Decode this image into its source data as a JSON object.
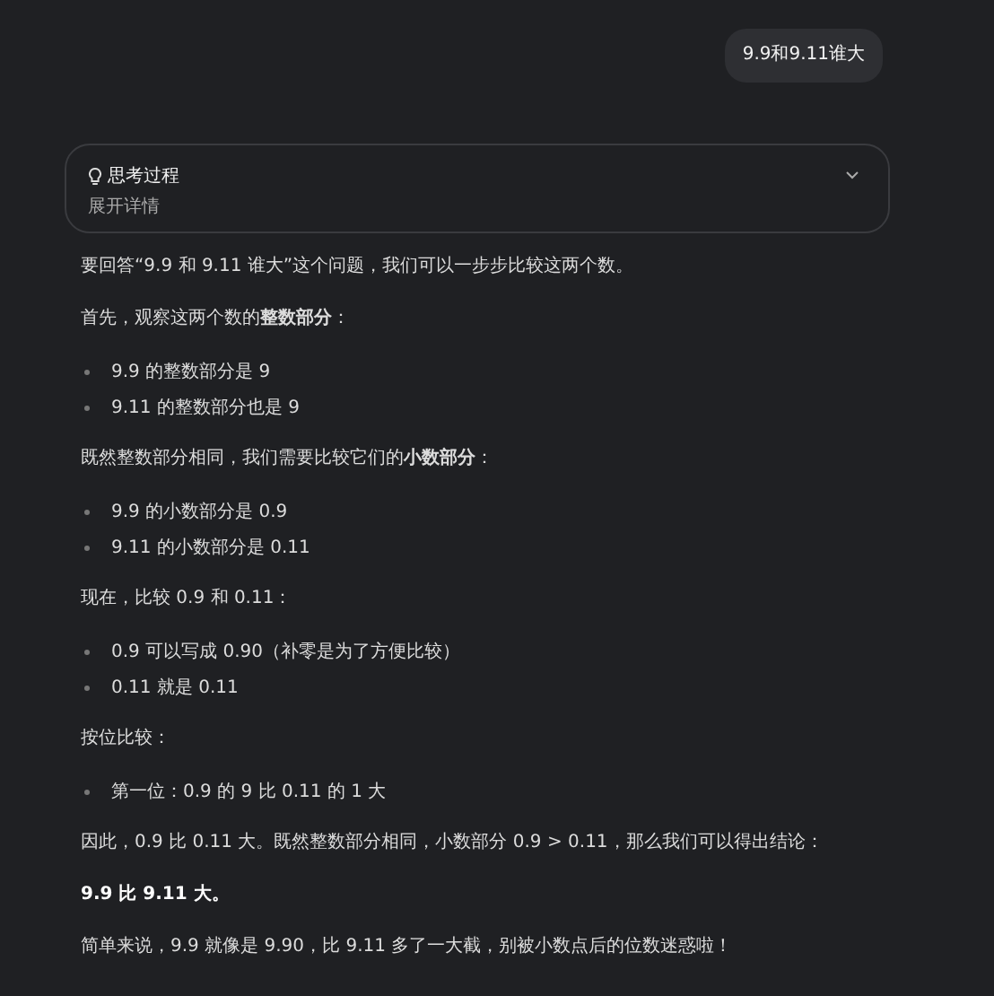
{
  "user_message": "9.9和9.11谁大",
  "thinking": {
    "title": "思考过程",
    "subtitle": "展开详情",
    "expanded": false
  },
  "answer": [
    {
      "kind": "paragraph",
      "text": "要回答“9.9 和 9.11 谁大”这个问题，我们可以一步步比较这两个数。"
    },
    {
      "kind": "paragraph",
      "text": "首先，观察这两个数的**整数部分**："
    },
    {
      "kind": "bullet",
      "text": "9.9 的整数部分是 9"
    },
    {
      "kind": "bullet",
      "text": "9.11 的整数部分也是 9"
    },
    {
      "kind": "paragraph",
      "text": "既然整数部分相同，我们需要比较它们的**小数部分**："
    },
    {
      "kind": "bullet",
      "text": "9.9 的小数部分是 0.9"
    },
    {
      "kind": "bullet",
      "text": "9.11 的小数部分是 0.11"
    },
    {
      "kind": "paragraph",
      "text": "现在，比较 0.9 和 0.11："
    },
    {
      "kind": "bullet",
      "text": "0.9 可以写成 0.90（补零是为了方便比较）"
    },
    {
      "kind": "bullet",
      "text": "0.11 就是 0.11"
    },
    {
      "kind": "paragraph",
      "text": "按位比较："
    },
    {
      "kind": "bullet",
      "text": "第一位：0.9 的 9 比 0.11 的 1 大"
    },
    {
      "kind": "paragraph",
      "text": "因此，0.9 比 0.11 大。既然整数部分相同，小数部分 0.9 > 0.11，那么我们可以得出结论："
    },
    {
      "kind": "conclusion",
      "text": "9.9 比 9.11 大。"
    },
    {
      "kind": "paragraph",
      "text": "简单来说，9.9 就像是 9.90，比 9.11 多了一大截，别被小数点后的位数迷惑啦！"
    }
  ]
}
